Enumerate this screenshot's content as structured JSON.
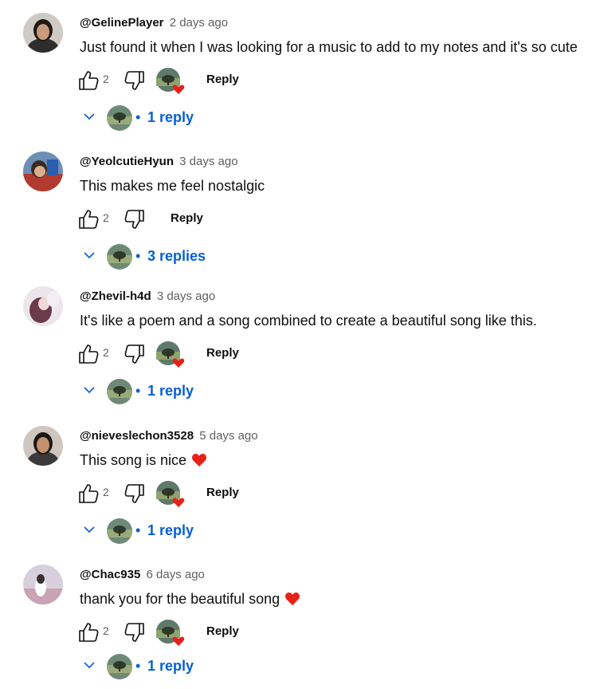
{
  "comments": [
    {
      "username": "@GelinePlayer",
      "time": "2 days ago",
      "text": "Just found it when I was looking for a music to add to my notes and it's so cute",
      "likes": "2",
      "reply_label": "Reply",
      "creator_heart": true,
      "replies_label": "1 reply",
      "avatar_color": "#3b3b3b"
    },
    {
      "username": "@YeolcutieHyun",
      "time": "3 days ago",
      "text": "This makes me feel nostalgic",
      "likes": "2",
      "reply_label": "Reply",
      "creator_heart": false,
      "replies_label": "3 replies",
      "avatar_color": "#2a5db0"
    },
    {
      "username": "@Zhevil-h4d",
      "time": "3 days ago",
      "text": "It's like a poem and a song combined to create a beautiful song like this.",
      "likes": "2",
      "reply_label": "Reply",
      "creator_heart": true,
      "replies_label": "1 reply",
      "avatar_color": "#7a4a5a"
    },
    {
      "username": "@nieveslechon3528",
      "time": "5 days ago",
      "text": "This song is nice",
      "likes": "2",
      "reply_label": "Reply",
      "creator_heart": true,
      "replies_label": "1 reply",
      "avatar_color": "#2b2b2b"
    },
    {
      "username": "@Chac935",
      "time": "6 days ago",
      "text": "thank you for the beautiful song",
      "likes": "2",
      "reply_label": "Reply",
      "creator_heart": true,
      "replies_label": "1 reply",
      "avatar_color": "#b8a8b8"
    }
  ],
  "colors": {
    "link": "#065fd4",
    "heart": "#e62117",
    "muted": "#606060"
  }
}
